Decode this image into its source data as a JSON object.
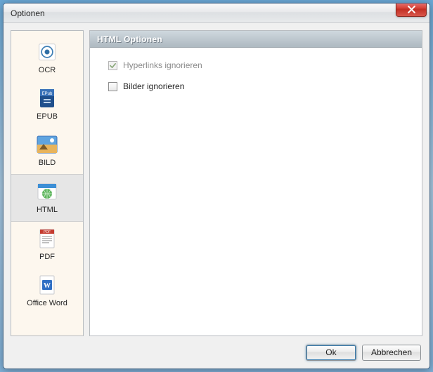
{
  "window": {
    "title": "Optionen"
  },
  "sidebar": {
    "items": [
      {
        "label": "OCR"
      },
      {
        "label": "EPUB"
      },
      {
        "label": "BILD"
      },
      {
        "label": "HTML"
      },
      {
        "label": "PDF"
      },
      {
        "label": "Office Word"
      }
    ],
    "selected_index": 3
  },
  "panel": {
    "title": "HTML Optionen",
    "options": [
      {
        "label": "Hyperlinks ignorieren",
        "checked": true,
        "enabled": false
      },
      {
        "label": "Bilder ignorieren",
        "checked": false,
        "enabled": true
      }
    ]
  },
  "buttons": {
    "ok": "Ok",
    "cancel": "Abbrechen"
  }
}
